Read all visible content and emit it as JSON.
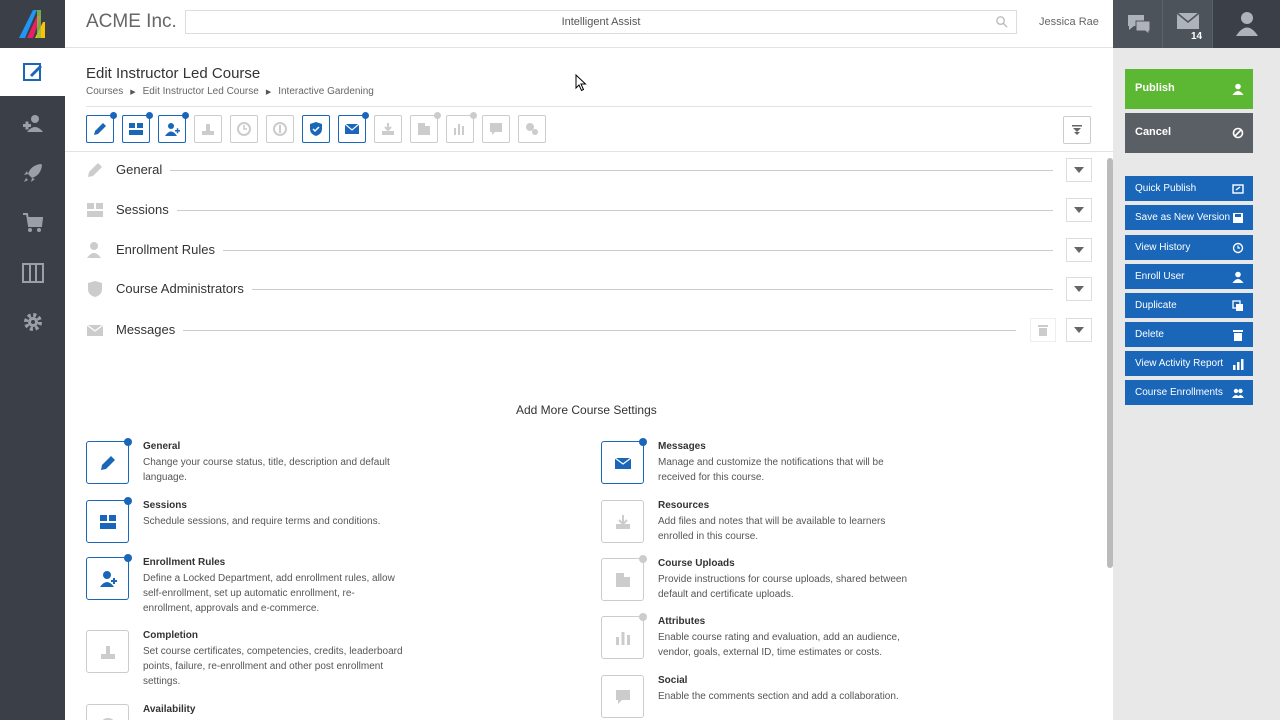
{
  "app": {
    "company": "ACME Inc.",
    "search_placeholder": "Intelligent Assist",
    "user": "Jessica Rae",
    "mail_count": "14"
  },
  "page": {
    "title": "Edit Instructor Led Course",
    "breadcrumbs": [
      "Courses",
      "Edit Instructor Led Course",
      "Interactive Gardening"
    ]
  },
  "nav": [
    {
      "name": "courses-icon",
      "active": true
    },
    {
      "name": "users-icon",
      "active": false
    },
    {
      "name": "rocket-icon",
      "active": false
    },
    {
      "name": "cart-icon",
      "active": false
    },
    {
      "name": "columns-icon",
      "active": false
    },
    {
      "name": "gear-icon",
      "active": false
    }
  ],
  "sections": [
    {
      "label": "General",
      "icon": "pencil-icon"
    },
    {
      "label": "Sessions",
      "icon": "sessions-icon"
    },
    {
      "label": "Enrollment Rules",
      "icon": "user-plus-icon"
    },
    {
      "label": "Course Administrators",
      "icon": "shield-icon"
    },
    {
      "label": "Messages",
      "icon": "envelope-icon"
    }
  ],
  "more_settings": {
    "title": "Add More Course Settings",
    "left": [
      {
        "title": "General",
        "desc": "Change your course status, title, description and default language."
      },
      {
        "title": "Sessions",
        "desc": "Schedule sessions, and require terms and conditions."
      },
      {
        "title": "Enrollment Rules",
        "desc": "Define a Locked Department, add enrollment rules, allow self-enrollment, set up automatic enrollment, re-enrollment, approvals and e-commerce."
      },
      {
        "title": "Completion",
        "desc": "Set course certificates, competencies, credits, leaderboard points, failure, re-enrollment and other post enrollment settings."
      },
      {
        "title": "Availability",
        "desc": ""
      }
    ],
    "right": [
      {
        "title": "Messages",
        "desc": "Manage and customize the notifications that will be received for this course."
      },
      {
        "title": "Resources",
        "desc": "Add files and notes that will be available to learners enrolled in this course."
      },
      {
        "title": "Course Uploads",
        "desc": "Provide instructions for course uploads, shared between default and certificate uploads."
      },
      {
        "title": "Attributes",
        "desc": "Enable course rating and evaluation, add an audience, vendor, goals, external ID, time estimates or costs."
      },
      {
        "title": "Social",
        "desc": "Enable the comments section and add a collaboration."
      }
    ]
  },
  "actions": {
    "publish": "Publish",
    "cancel": "Cancel",
    "items": [
      "Quick Publish",
      "Save as New Version",
      "View History",
      "Enroll User",
      "Duplicate",
      "Delete",
      "View Activity Report",
      "Course Enrollments"
    ]
  },
  "colors": {
    "accent": "#1a66b8",
    "publish": "#5cb833",
    "rail": "#3a3f48"
  }
}
